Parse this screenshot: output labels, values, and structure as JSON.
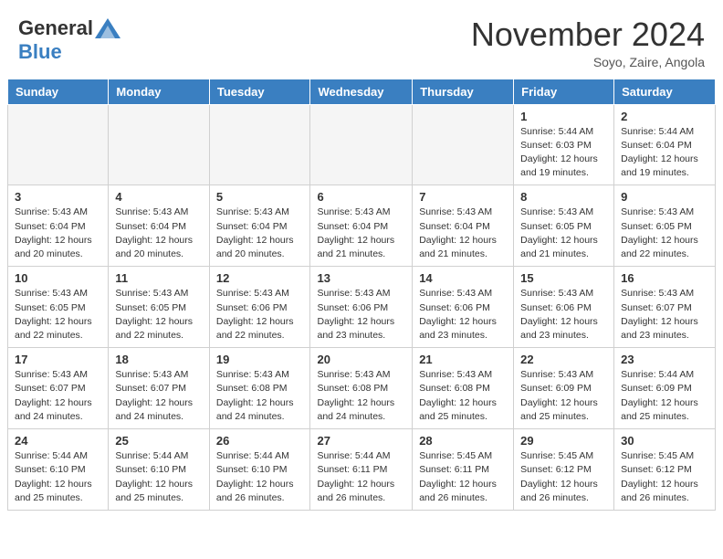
{
  "logo": {
    "general": "General",
    "blue": "Blue"
  },
  "header": {
    "month": "November 2024",
    "location": "Soyo, Zaire, Angola"
  },
  "weekdays": [
    "Sunday",
    "Monday",
    "Tuesday",
    "Wednesday",
    "Thursday",
    "Friday",
    "Saturday"
  ],
  "weeks": [
    [
      {
        "day": "",
        "info": ""
      },
      {
        "day": "",
        "info": ""
      },
      {
        "day": "",
        "info": ""
      },
      {
        "day": "",
        "info": ""
      },
      {
        "day": "",
        "info": ""
      },
      {
        "day": "1",
        "info": "Sunrise: 5:44 AM\nSunset: 6:03 PM\nDaylight: 12 hours and 19 minutes."
      },
      {
        "day": "2",
        "info": "Sunrise: 5:44 AM\nSunset: 6:04 PM\nDaylight: 12 hours and 19 minutes."
      }
    ],
    [
      {
        "day": "3",
        "info": "Sunrise: 5:43 AM\nSunset: 6:04 PM\nDaylight: 12 hours and 20 minutes."
      },
      {
        "day": "4",
        "info": "Sunrise: 5:43 AM\nSunset: 6:04 PM\nDaylight: 12 hours and 20 minutes."
      },
      {
        "day": "5",
        "info": "Sunrise: 5:43 AM\nSunset: 6:04 PM\nDaylight: 12 hours and 20 minutes."
      },
      {
        "day": "6",
        "info": "Sunrise: 5:43 AM\nSunset: 6:04 PM\nDaylight: 12 hours and 21 minutes."
      },
      {
        "day": "7",
        "info": "Sunrise: 5:43 AM\nSunset: 6:04 PM\nDaylight: 12 hours and 21 minutes."
      },
      {
        "day": "8",
        "info": "Sunrise: 5:43 AM\nSunset: 6:05 PM\nDaylight: 12 hours and 21 minutes."
      },
      {
        "day": "9",
        "info": "Sunrise: 5:43 AM\nSunset: 6:05 PM\nDaylight: 12 hours and 22 minutes."
      }
    ],
    [
      {
        "day": "10",
        "info": "Sunrise: 5:43 AM\nSunset: 6:05 PM\nDaylight: 12 hours and 22 minutes."
      },
      {
        "day": "11",
        "info": "Sunrise: 5:43 AM\nSunset: 6:05 PM\nDaylight: 12 hours and 22 minutes."
      },
      {
        "day": "12",
        "info": "Sunrise: 5:43 AM\nSunset: 6:06 PM\nDaylight: 12 hours and 22 minutes."
      },
      {
        "day": "13",
        "info": "Sunrise: 5:43 AM\nSunset: 6:06 PM\nDaylight: 12 hours and 23 minutes."
      },
      {
        "day": "14",
        "info": "Sunrise: 5:43 AM\nSunset: 6:06 PM\nDaylight: 12 hours and 23 minutes."
      },
      {
        "day": "15",
        "info": "Sunrise: 5:43 AM\nSunset: 6:06 PM\nDaylight: 12 hours and 23 minutes."
      },
      {
        "day": "16",
        "info": "Sunrise: 5:43 AM\nSunset: 6:07 PM\nDaylight: 12 hours and 23 minutes."
      }
    ],
    [
      {
        "day": "17",
        "info": "Sunrise: 5:43 AM\nSunset: 6:07 PM\nDaylight: 12 hours and 24 minutes."
      },
      {
        "day": "18",
        "info": "Sunrise: 5:43 AM\nSunset: 6:07 PM\nDaylight: 12 hours and 24 minutes."
      },
      {
        "day": "19",
        "info": "Sunrise: 5:43 AM\nSunset: 6:08 PM\nDaylight: 12 hours and 24 minutes."
      },
      {
        "day": "20",
        "info": "Sunrise: 5:43 AM\nSunset: 6:08 PM\nDaylight: 12 hours and 24 minutes."
      },
      {
        "day": "21",
        "info": "Sunrise: 5:43 AM\nSunset: 6:08 PM\nDaylight: 12 hours and 25 minutes."
      },
      {
        "day": "22",
        "info": "Sunrise: 5:43 AM\nSunset: 6:09 PM\nDaylight: 12 hours and 25 minutes."
      },
      {
        "day": "23",
        "info": "Sunrise: 5:44 AM\nSunset: 6:09 PM\nDaylight: 12 hours and 25 minutes."
      }
    ],
    [
      {
        "day": "24",
        "info": "Sunrise: 5:44 AM\nSunset: 6:10 PM\nDaylight: 12 hours and 25 minutes."
      },
      {
        "day": "25",
        "info": "Sunrise: 5:44 AM\nSunset: 6:10 PM\nDaylight: 12 hours and 25 minutes."
      },
      {
        "day": "26",
        "info": "Sunrise: 5:44 AM\nSunset: 6:10 PM\nDaylight: 12 hours and 26 minutes."
      },
      {
        "day": "27",
        "info": "Sunrise: 5:44 AM\nSunset: 6:11 PM\nDaylight: 12 hours and 26 minutes."
      },
      {
        "day": "28",
        "info": "Sunrise: 5:45 AM\nSunset: 6:11 PM\nDaylight: 12 hours and 26 minutes."
      },
      {
        "day": "29",
        "info": "Sunrise: 5:45 AM\nSunset: 6:12 PM\nDaylight: 12 hours and 26 minutes."
      },
      {
        "day": "30",
        "info": "Sunrise: 5:45 AM\nSunset: 6:12 PM\nDaylight: 12 hours and 26 minutes."
      }
    ]
  ]
}
